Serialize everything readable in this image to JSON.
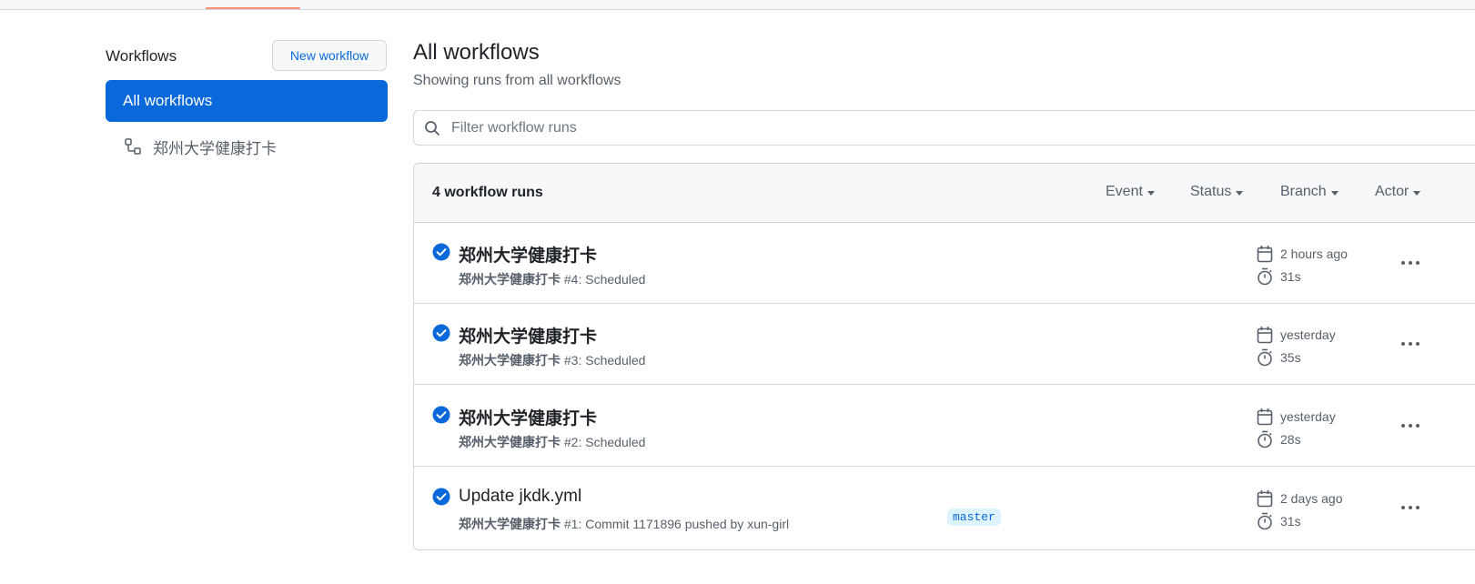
{
  "sidebar": {
    "title": "Workflows",
    "new_workflow_label": "New workflow",
    "active_item_label": "All workflows",
    "items": [
      {
        "label": "郑州大学健康打卡",
        "icon": "workflow-icon"
      }
    ]
  },
  "header": {
    "title": "All workflows",
    "subtitle": "Showing runs from all workflows"
  },
  "filter": {
    "placeholder": "Filter workflow runs",
    "value": ""
  },
  "runs": {
    "count_label": "4 workflow runs",
    "filters": [
      "Event",
      "Status",
      "Branch",
      "Actor"
    ],
    "rows": [
      {
        "status": "success",
        "title": "郑州大学健康打卡",
        "workflow": "郑州大学健康打卡",
        "detail": " #4: Scheduled",
        "branch": "",
        "time": "2 hours ago",
        "duration": "31s"
      },
      {
        "status": "success",
        "title": "郑州大学健康打卡",
        "workflow": "郑州大学健康打卡",
        "detail": " #3: Scheduled",
        "branch": "",
        "time": "yesterday",
        "duration": "35s"
      },
      {
        "status": "success",
        "title": "郑州大学健康打卡",
        "workflow": "郑州大学健康打卡",
        "detail": " #2: Scheduled",
        "branch": "",
        "time": "yesterday",
        "duration": "28s"
      },
      {
        "status": "success",
        "title": "Update jkdk.yml",
        "workflow": "郑州大学健康打卡",
        "detail": " #1: Commit 1171896 pushed by xun-girl",
        "branch": "master",
        "time": "2 days ago",
        "duration": "31s"
      }
    ]
  },
  "colors": {
    "accent": "#0969da",
    "text": "#1f2328",
    "muted": "#57606a",
    "border": "#d0d7de",
    "tab_underline": "#fd8c73"
  }
}
